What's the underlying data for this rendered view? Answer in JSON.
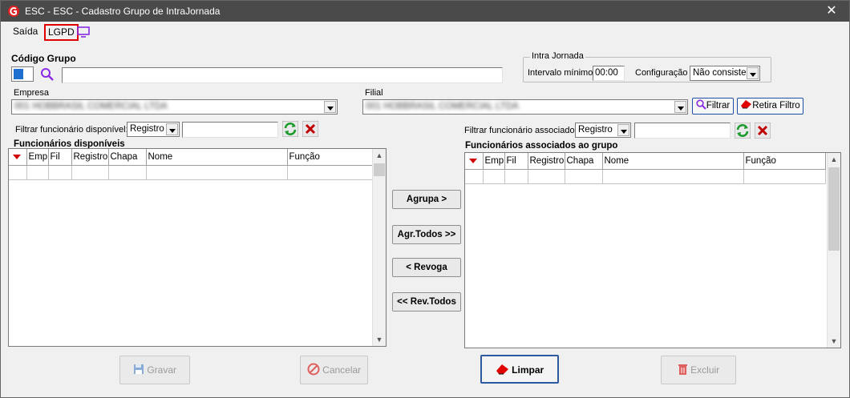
{
  "window": {
    "title": "ESC - ESC - Cadastro Grupo de IntraJornada",
    "close": "✕"
  },
  "menu": {
    "saida": "Saída",
    "lgpd": "LGPD"
  },
  "codigo_grupo": {
    "label": "Código Grupo",
    "value": ""
  },
  "intra_jornada": {
    "legend": "Intra Jornada",
    "intervalo_label": "Intervalo mínimo",
    "intervalo_value": "00:00",
    "config_label": "Configuração",
    "config_value": "Não consiste"
  },
  "empresa": {
    "label": "Empresa",
    "value": "001 HOBBRASIL COMERCIAL LTDA"
  },
  "filial": {
    "label": "Filial",
    "value": "001 HOBBRASIL COMERCIAL LTDA"
  },
  "buttons": {
    "filtrar": "Filtrar",
    "retira_filtro": "Retira Filtro",
    "agrupa": "Agrupa >",
    "agr_todos": "Agr.Todos >>",
    "revoga": "< Revoga",
    "rev_todos": "<< Rev.Todos",
    "gravar": "Gravar",
    "cancelar": "Cancelar",
    "limpar": "Limpar",
    "excluir": "Excluir"
  },
  "left_panel": {
    "filter_label": "Filtrar funcionário disponível:",
    "filter_select": "Registro",
    "filter_value": "",
    "title": "Funcionários disponíveis",
    "columns": [
      "Emp",
      "Fil",
      "Registro",
      "Chapa",
      "Nome",
      "Função"
    ]
  },
  "right_panel": {
    "filter_label": "Filtrar funcionário associado:",
    "filter_select": "Registro",
    "filter_value": "",
    "title": "Funcionários associados ao grupo",
    "columns": [
      "Emp",
      "Fil",
      "Registro",
      "Chapa",
      "Nome",
      "Função"
    ]
  },
  "colors": {
    "titlebar": "#4a4a4a",
    "accent_red": "#d00000",
    "highlight_blue": "#2c5aa0",
    "icon_purple": "#8a2be2"
  }
}
